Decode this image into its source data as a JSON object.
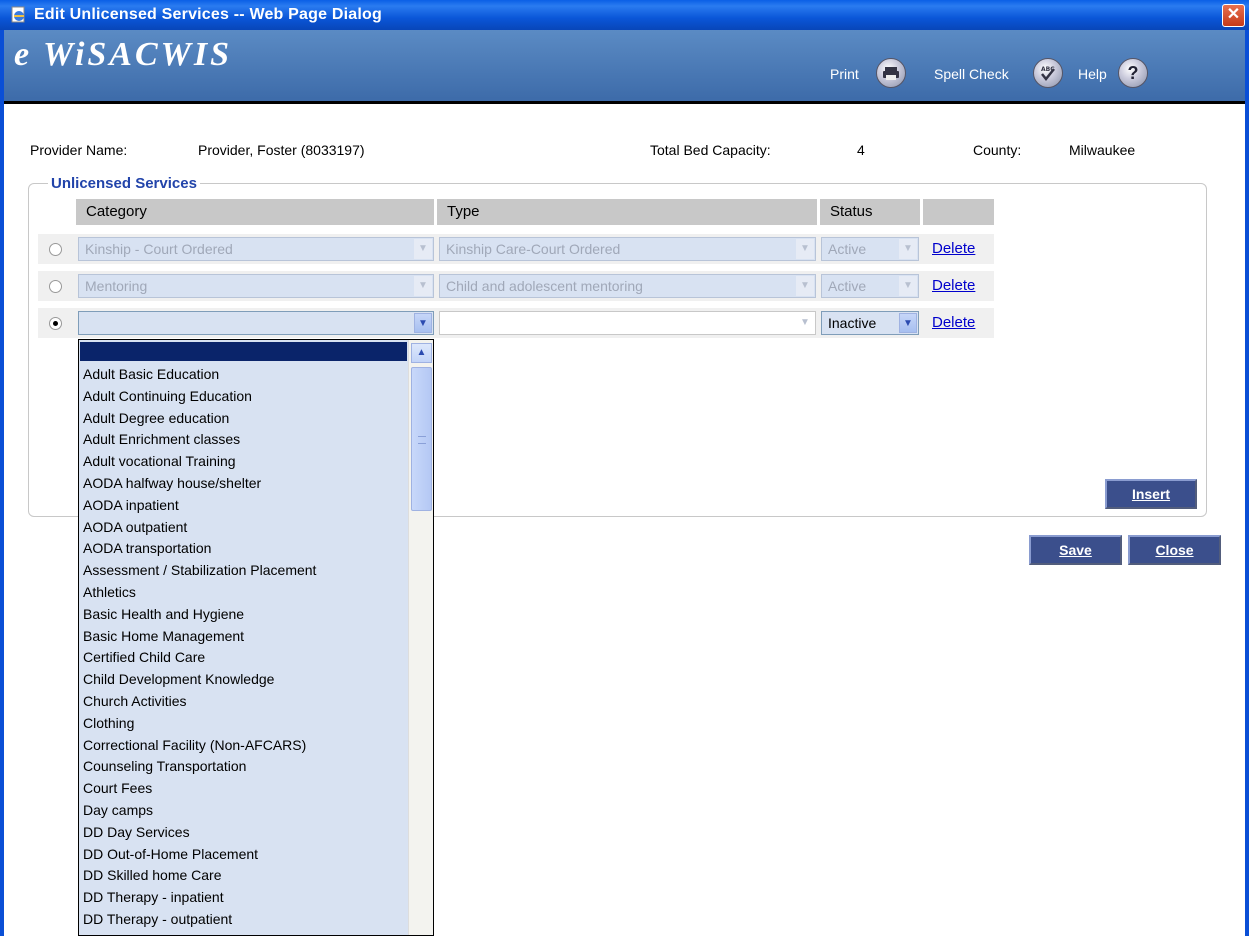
{
  "window": {
    "title": "Edit Unlicensed Services -- Web Page Dialog",
    "close_glyph": "✕"
  },
  "header": {
    "logo": "e WiSACWIS",
    "print_label": "Print",
    "spell_check_label": "Spell Check",
    "help_label": "Help"
  },
  "info": {
    "provider_name_label": "Provider Name:",
    "provider_name_value": "Provider, Foster (8033197)",
    "bed_capacity_label": "Total Bed Capacity:",
    "bed_capacity_value": "4",
    "county_label": "County:",
    "county_value": "Milwaukee"
  },
  "services": {
    "legend": "Unlicensed Services",
    "columns": [
      "Category",
      "Type",
      "Status"
    ],
    "rows": [
      {
        "category": "Kinship - Court Ordered",
        "type": "Kinship Care-Court Ordered",
        "status": "Active",
        "delete": "Delete",
        "selected": false
      },
      {
        "category": "Mentoring",
        "type": "Child and adolescent mentoring",
        "status": "Active",
        "delete": "Delete",
        "selected": false
      },
      {
        "category": "",
        "type": "",
        "status": "Inactive",
        "delete": "Delete",
        "selected": true
      }
    ]
  },
  "category_options": [
    "Adult Basic Education",
    "Adult Continuing Education",
    "Adult Degree education",
    "Adult Enrichment classes",
    "Adult vocational Training",
    "AODA halfway house/shelter",
    "AODA inpatient",
    "AODA outpatient",
    "AODA transportation",
    "Assessment / Stabilization Placement",
    "Athletics",
    "Basic Health and Hygiene",
    "Basic Home Management",
    "Certified Child Care",
    "Child Development Knowledge",
    "Church Activities",
    "Clothing",
    "Correctional Facility (Non-AFCARS)",
    "Counseling Transportation",
    "Court Fees",
    "Day camps",
    "DD Day Services",
    "DD Out-of-Home Placement",
    "DD Skilled home Care",
    "DD Therapy - inpatient",
    "DD Therapy - outpatient"
  ],
  "buttons": {
    "insert": "Insert",
    "save": "Save",
    "close": "Close"
  }
}
